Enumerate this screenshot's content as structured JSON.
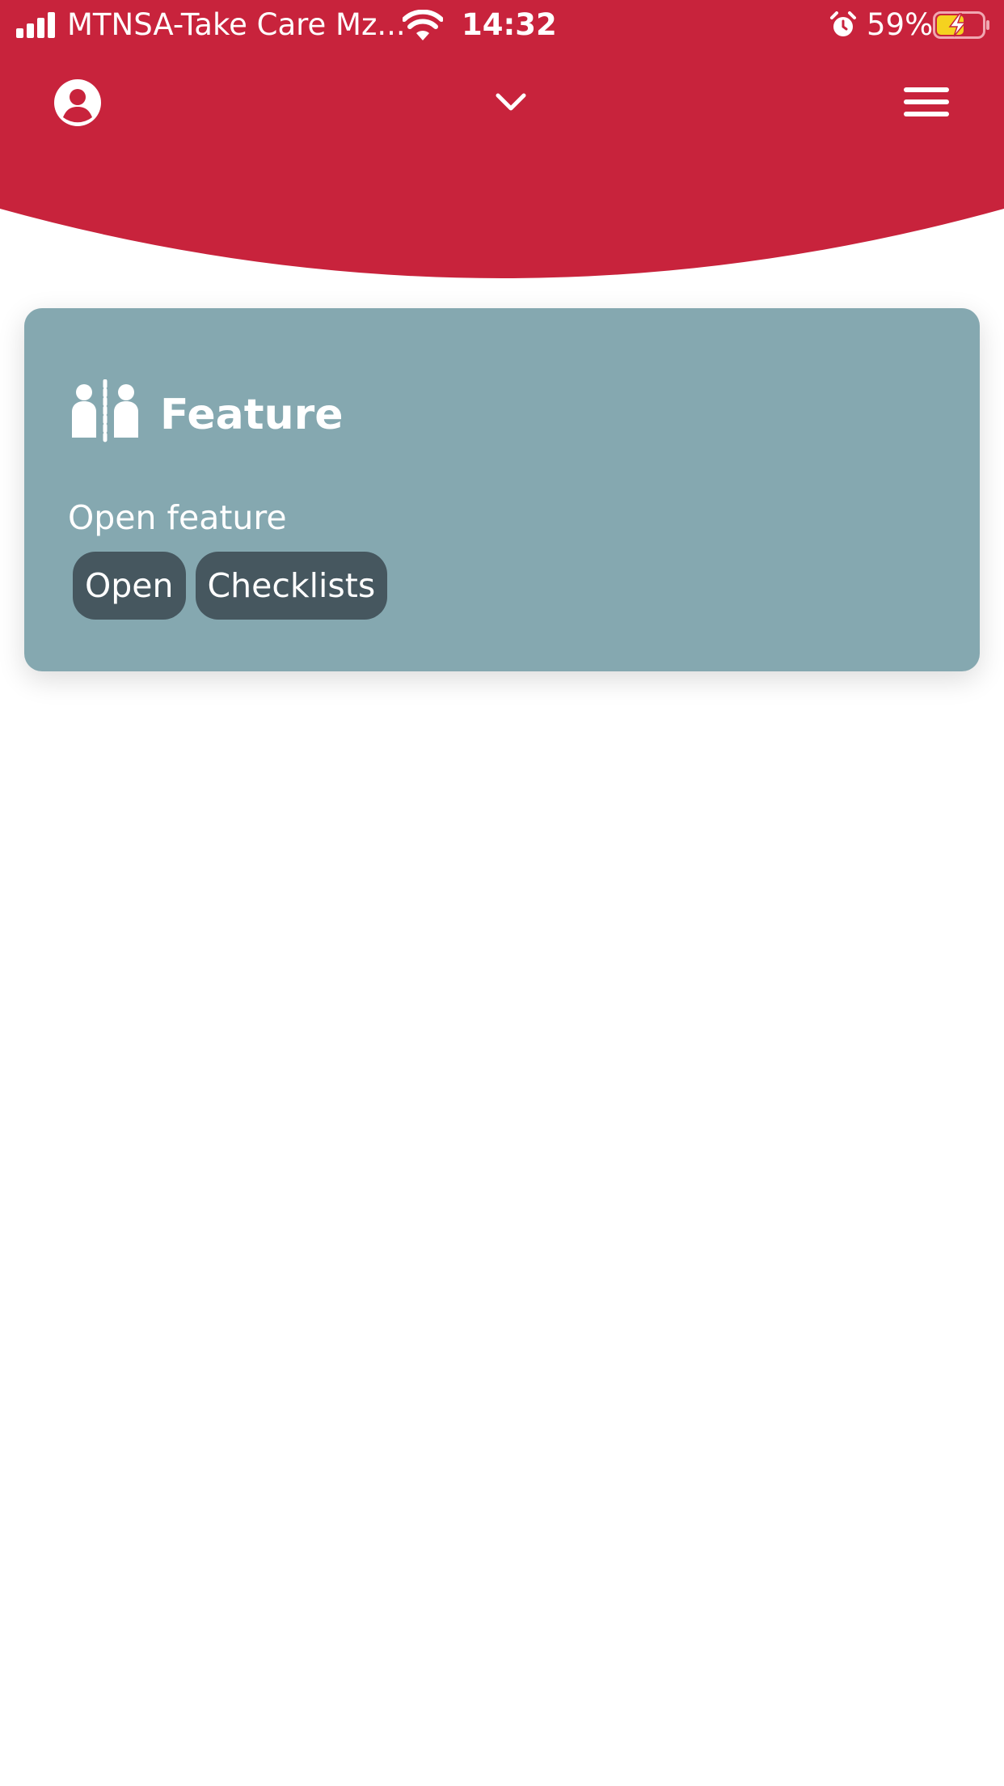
{
  "colors": {
    "header_red": "#c8233c",
    "card_bg": "#85a8b0",
    "pill_bg": "#46575f",
    "battery_charging": "#f5d21f",
    "text_on_dark": "#ffffff"
  },
  "status_bar": {
    "carrier": "MTNSA-Take Care Mz...",
    "time": "14:32",
    "battery_percent": "59%",
    "signal_icon": "signal-bars-icon",
    "wifi_icon": "wifi-icon",
    "alarm_icon": "alarm-clock-icon",
    "battery_icon": "battery-charging-icon",
    "battery_level": 0.59
  },
  "nav": {
    "left_icon": "user-profile-icon",
    "center_icon": "chevron-down-icon",
    "right_icon": "hamburger-menu-icon"
  },
  "card": {
    "icon": "feature-people-icon",
    "title": "Feature",
    "subtitle": "Open feature",
    "buttons": [
      {
        "label": "Open"
      },
      {
        "label": "Checklists"
      }
    ]
  }
}
